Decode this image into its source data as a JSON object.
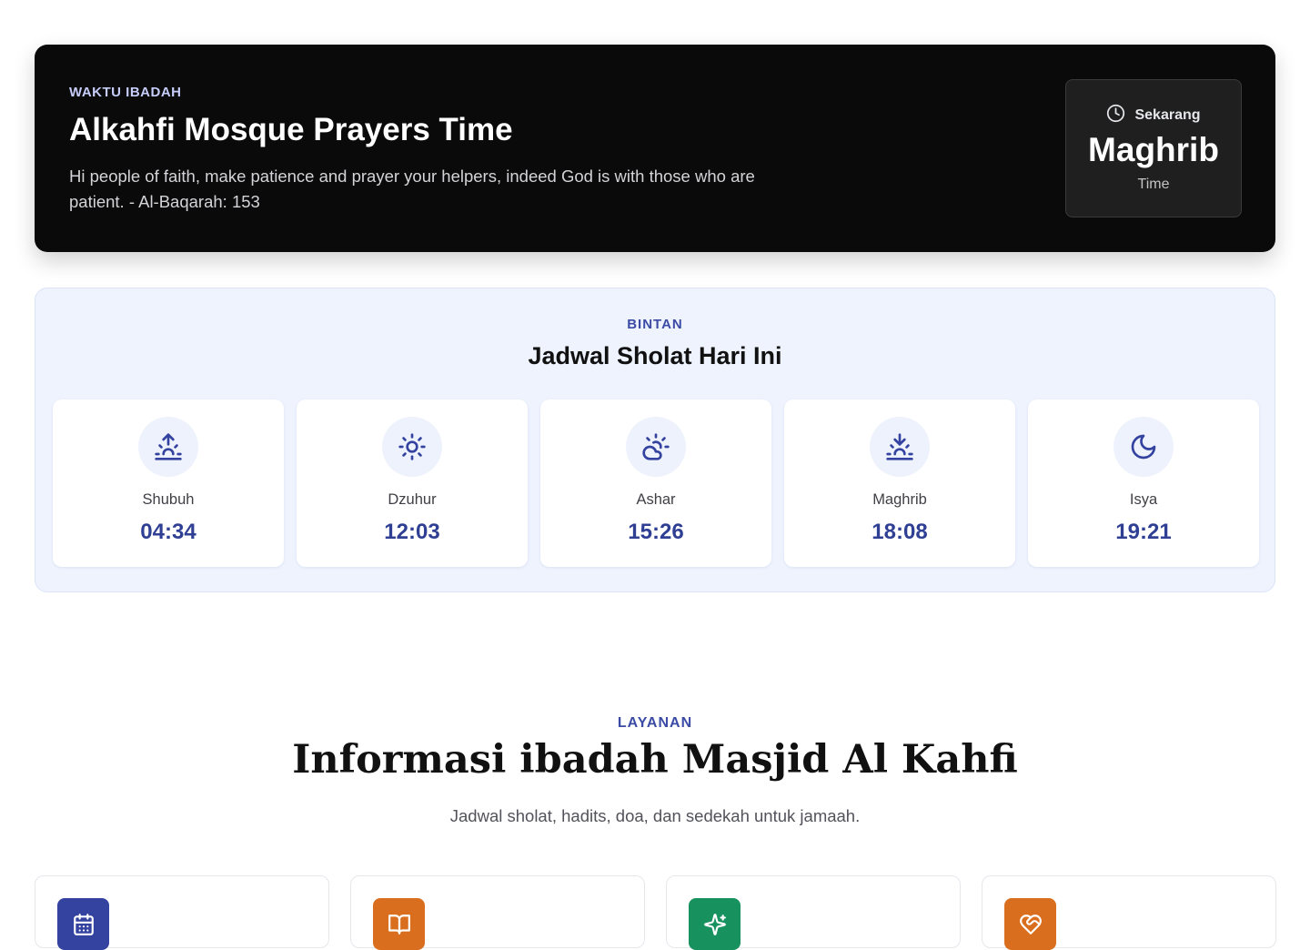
{
  "hero": {
    "eyebrow": "WAKTU IBADAH",
    "title": "Alkahfi Mosque Prayers Time",
    "quote": "Hi people of faith, make patience and prayer your helpers, indeed God is with those who are patient. - Al-Baqarah: 153",
    "now": {
      "label": "Sekarang",
      "prayer": "Maghrib",
      "suffix": "Time",
      "icon": "clock-icon"
    }
  },
  "schedule": {
    "eyebrow": "BINTAN",
    "title": "Jadwal Sholat Hari Ini",
    "accent_color": "#2f3f94",
    "prayers": [
      {
        "name": "Shubuh",
        "time": "04:34",
        "icon": "sunrise-icon"
      },
      {
        "name": "Dzuhur",
        "time": "12:03",
        "icon": "sun-icon"
      },
      {
        "name": "Ashar",
        "time": "15:26",
        "icon": "cloud-sun-icon"
      },
      {
        "name": "Maghrib",
        "time": "18:08",
        "icon": "sunset-icon"
      },
      {
        "name": "Isya",
        "time": "19:21",
        "icon": "moon-icon"
      }
    ]
  },
  "services": {
    "eyebrow": "LAYANAN",
    "title": "Informasi ibadah Masjid Al Kahfi",
    "subtitle": "Jadwal sholat, hadits, doa, dan sedekah untuk jamaah.",
    "cards": [
      {
        "icon": "calendar-icon",
        "color": "#3442a0"
      },
      {
        "icon": "book-open-icon",
        "color": "#d96f1e"
      },
      {
        "icon": "sparkles-icon",
        "color": "#17915e"
      },
      {
        "icon": "heart-handshake-icon",
        "color": "#d96f1e"
      }
    ]
  }
}
